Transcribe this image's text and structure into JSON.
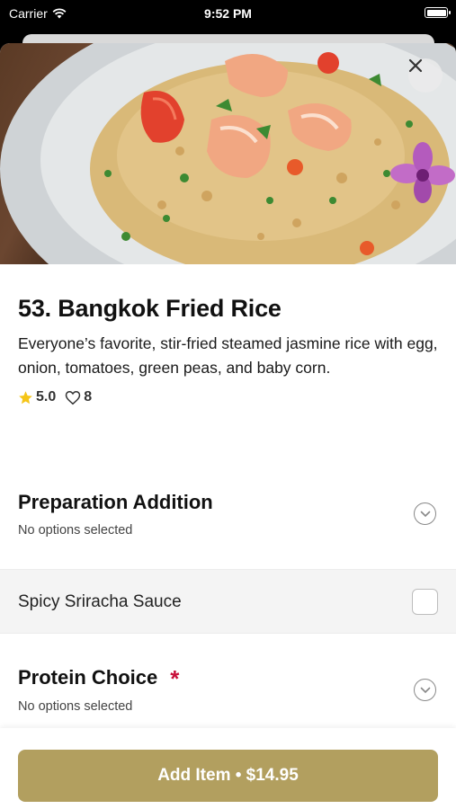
{
  "status_bar": {
    "carrier": "Carrier",
    "time": "9:52 PM"
  },
  "item": {
    "title": "53. Bangkok Fried Rice",
    "description": "Everyone’s favorite, stir-fried steamed jasmine rice with egg, onion, tomatoes, green peas, and baby corn.",
    "rating": "5.0",
    "likes": "8"
  },
  "sections": {
    "preparation": {
      "title": "Preparation Addition",
      "subtitle": "No options selected"
    },
    "preparation_option": {
      "label": "Spicy Sriracha Sauce"
    },
    "protein": {
      "title": "Protein Choice",
      "required_mark": "*",
      "subtitle": "No options selected"
    }
  },
  "add_button": {
    "label": "Add Item • $14.95"
  },
  "icons": {
    "close": "close-icon",
    "star": "star-icon",
    "heart": "heart-icon",
    "chevron": "chevron-down-icon"
  },
  "colors": {
    "accent": "#b29f5f",
    "required": "#c8103a",
    "star": "#f5c518"
  }
}
